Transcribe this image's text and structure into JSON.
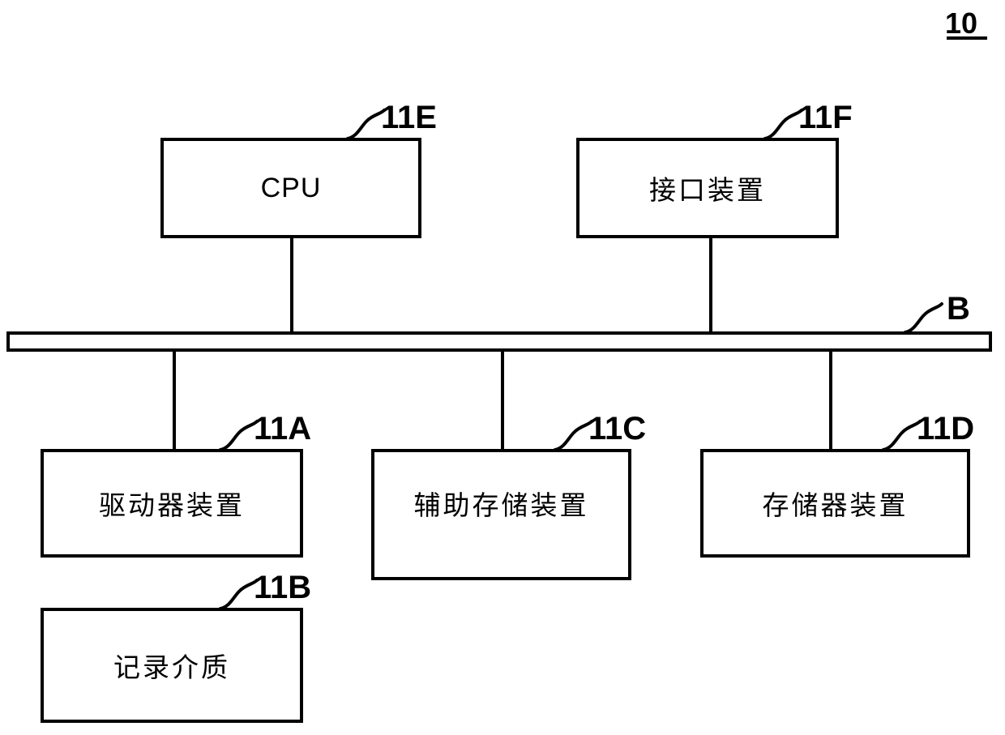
{
  "figure": {
    "number": "10",
    "bus_label": "B"
  },
  "boxes": [
    {
      "id": "cpu",
      "label": "CPU",
      "ref": "11E",
      "script": "latin"
    },
    {
      "id": "interface-device",
      "label": "接口装置",
      "ref": "11F",
      "script": "cjk"
    },
    {
      "id": "drive-device",
      "label": "驱动器装置",
      "ref": "11A",
      "script": "cjk"
    },
    {
      "id": "auxiliary-storage-device",
      "label": "辅助存储装置",
      "ref": "11C",
      "script": "cjk"
    },
    {
      "id": "memory-device",
      "label": "存储器装置",
      "ref": "11D",
      "script": "cjk"
    },
    {
      "id": "recording-medium",
      "label": "记录介质",
      "ref": "11B",
      "script": "cjk"
    }
  ],
  "colors": {
    "ink": "#000000",
    "paper": "#ffffff"
  }
}
